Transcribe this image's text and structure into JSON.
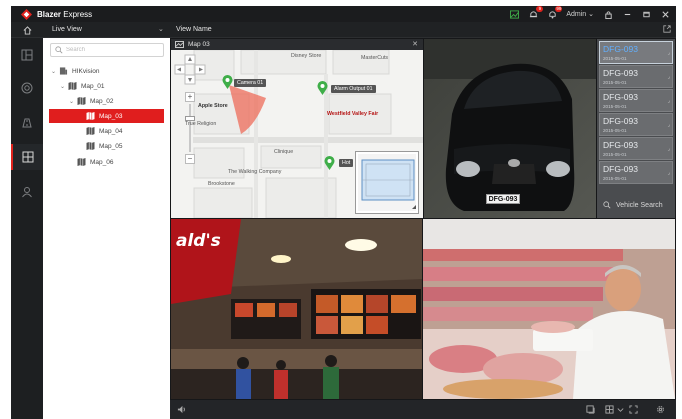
{
  "app": {
    "brand": "Blazer",
    "product": "Express",
    "admin_label": "Admin",
    "badges": {
      "alarm": "9",
      "notify": "99"
    }
  },
  "colors": {
    "accent": "#e0231d",
    "selected_plate": "#62b0ff"
  },
  "header": {
    "live_view": "Live View",
    "view_name": "View Name"
  },
  "rail_icons": [
    "home-icon",
    "dashboard-icon",
    "camera-icon",
    "road-icon",
    "grid-icon",
    "user-icon"
  ],
  "tree": {
    "search_placeholder": "Search",
    "items": [
      {
        "label": "HIKvision"
      },
      {
        "label": "Map_01"
      },
      {
        "label": "Map_02"
      },
      {
        "label": "Map_03"
      },
      {
        "label": "Map_04"
      },
      {
        "label": "Map_05"
      },
      {
        "label": "Map_06"
      }
    ]
  },
  "map": {
    "title": "Map 03",
    "labels": {
      "disney": "Disney Store",
      "mastercuts": "MasterCuts",
      "apple": "Apple Store",
      "true_religion": "True Religion",
      "westfield": "Westfield Valley Fair",
      "clinique": "Clinique",
      "walking": "The Walking Company",
      "brookstone": "Brookstone"
    },
    "tags": {
      "camera": "Camera 01",
      "alarm": "Alarm Output 01",
      "hot": "Hot"
    }
  },
  "car": {
    "plate": "DFG-093"
  },
  "plates": {
    "items": [
      {
        "number": "DFG-093",
        "date": "2015-05-01"
      },
      {
        "number": "DFG-093",
        "date": "2015-05-01"
      },
      {
        "number": "DFG-093",
        "date": "2015-05-01"
      },
      {
        "number": "DFG-093",
        "date": "2015-05-01"
      },
      {
        "number": "DFG-093",
        "date": "2015-05-01"
      },
      {
        "number": "DFG-093",
        "date": "2015-05-01"
      }
    ],
    "search_label": "Vehicle Search"
  },
  "restaurant": {
    "sign_text": "ald's"
  }
}
